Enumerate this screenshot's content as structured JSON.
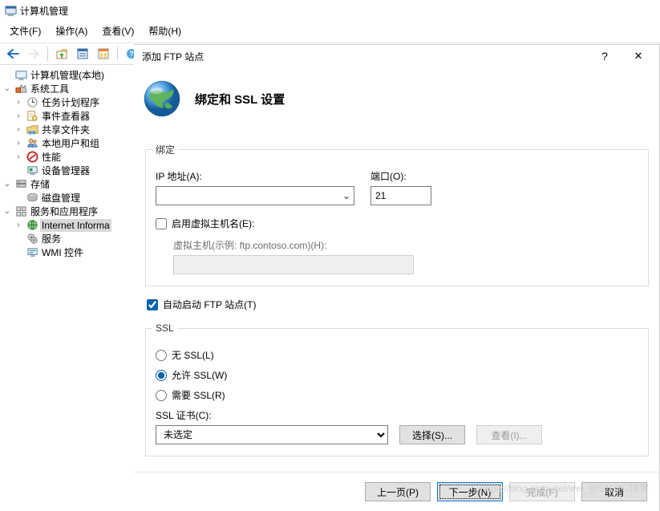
{
  "app": {
    "title": "计算机管理"
  },
  "menu": {
    "file": "文件(F)",
    "action": "操作(A)",
    "view": "查看(V)",
    "help": "帮助(H)"
  },
  "tree": {
    "root": "计算机管理(本地)",
    "systools": "系统工具",
    "tasksched": "任务计划程序",
    "eventviewer": "事件查看器",
    "shared": "共享文件夹",
    "localusers": "本地用户和组",
    "perf": "性能",
    "devmgr": "设备管理器",
    "storage": "存储",
    "diskmgmt": "磁盘管理",
    "services_apps": "服务和应用程序",
    "iis": "Internet Informa",
    "services": "服务",
    "wmi": "WMI 控件"
  },
  "dialog": {
    "title": "添加 FTP 站点",
    "heading": "绑定和 SSL 设置",
    "binding_group": "绑定",
    "ip_label": "IP 地址(A):",
    "ip_value": "",
    "port_label": "端口(O):",
    "port_value": "21",
    "enable_vh_label": "启用虚拟主机名(E):",
    "enable_vh_checked": false,
    "vh_label": "虚拟主机(示例: ftp.contoso.com)(H):",
    "vh_value": "",
    "autostart_label": "自动启动 FTP 站点(T)",
    "autostart_checked": true,
    "ssl_group": "SSL",
    "ssl_none": "无 SSL(L)",
    "ssl_allow": "允许 SSL(W)",
    "ssl_require": "需要 SSL(R)",
    "ssl_selected": "allow",
    "cert_label": "SSL 证书(C):",
    "cert_value": "未选定",
    "btn_select": "选择(S)...",
    "btn_view": "查看(I)...",
    "btn_prev": "上一页(P)",
    "btn_next": "下一步(N)",
    "btn_finish": "完成(F)",
    "btn_cancel": "取消"
  },
  "watermark": "https://blog.csdn.net/wei_@51CTO博客"
}
